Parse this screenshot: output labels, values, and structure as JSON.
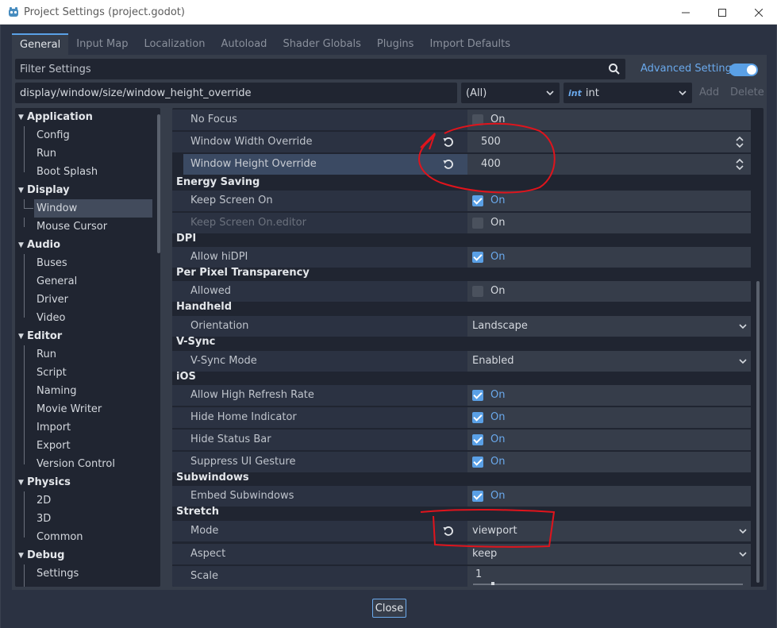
{
  "window": {
    "title": "Project Settings (project.godot)"
  },
  "tabs": [
    "General",
    "Input Map",
    "Localization",
    "Autoload",
    "Shader Globals",
    "Plugins",
    "Import Defaults"
  ],
  "filter": {
    "placeholder": "Filter Settings",
    "advanced_label": "Advanced Settings",
    "advanced_on": true
  },
  "pathbar": {
    "path": "display/window/size/window_height_override",
    "category": "(All)",
    "type_icon": "int",
    "type": "int",
    "add_label": "Add",
    "delete_label": "Delete"
  },
  "tree": [
    {
      "label": "Application",
      "cat": true
    },
    {
      "label": "Config"
    },
    {
      "label": "Run"
    },
    {
      "label": "Boot Splash"
    },
    {
      "label": "Display",
      "cat": true
    },
    {
      "label": "Window",
      "selected": true
    },
    {
      "label": "Mouse Cursor"
    },
    {
      "label": "Audio",
      "cat": true
    },
    {
      "label": "Buses"
    },
    {
      "label": "General"
    },
    {
      "label": "Driver"
    },
    {
      "label": "Video"
    },
    {
      "label": "Editor",
      "cat": true
    },
    {
      "label": "Run"
    },
    {
      "label": "Script"
    },
    {
      "label": "Naming"
    },
    {
      "label": "Movie Writer"
    },
    {
      "label": "Import"
    },
    {
      "label": "Export"
    },
    {
      "label": "Version Control"
    },
    {
      "label": "Physics",
      "cat": true
    },
    {
      "label": "2D"
    },
    {
      "label": "3D"
    },
    {
      "label": "Common"
    },
    {
      "label": "Debug",
      "cat": true
    },
    {
      "label": "Settings"
    }
  ],
  "inspector": {
    "no_focus": {
      "label": "No Focus",
      "value": "On",
      "checked": false
    },
    "width_override": {
      "label": "Window Width Override",
      "value": "500"
    },
    "height_override": {
      "label": "Window Height Override",
      "value": "400"
    },
    "energy_saving": "Energy Saving",
    "keep_screen_on": {
      "label": "Keep Screen On",
      "value": "On",
      "checked": true
    },
    "keep_screen_on_editor": {
      "label": "Keep Screen On.editor",
      "value": "On",
      "checked": false
    },
    "dpi": "DPI",
    "allow_hidpi": {
      "label": "Allow hiDPI",
      "value": "On",
      "checked": true
    },
    "per_pixel": "Per Pixel Transparency",
    "allowed": {
      "label": "Allowed",
      "value": "On",
      "checked": false
    },
    "handheld": "Handheld",
    "orientation": {
      "label": "Orientation",
      "value": "Landscape"
    },
    "vsync": "V-Sync",
    "vsync_mode": {
      "label": "V-Sync Mode",
      "value": "Enabled"
    },
    "ios": "iOS",
    "high_refresh": {
      "label": "Allow High Refresh Rate",
      "value": "On",
      "checked": true
    },
    "hide_home": {
      "label": "Hide Home Indicator",
      "value": "On",
      "checked": true
    },
    "hide_status": {
      "label": "Hide Status Bar",
      "value": "On",
      "checked": true
    },
    "suppress_gesture": {
      "label": "Suppress UI Gesture",
      "value": "On",
      "checked": true
    },
    "subwindows": "Subwindows",
    "embed_subwindows": {
      "label": "Embed Subwindows",
      "value": "On",
      "checked": true
    },
    "stretch": "Stretch",
    "mode": {
      "label": "Mode",
      "value": "viewport"
    },
    "aspect": {
      "label": "Aspect",
      "value": "keep"
    },
    "scale": {
      "label": "Scale",
      "value": "1"
    }
  },
  "footer": {
    "close_label": "Close"
  },
  "colors": {
    "accent": "#5aa0e6",
    "annotation": "#e0141c"
  }
}
